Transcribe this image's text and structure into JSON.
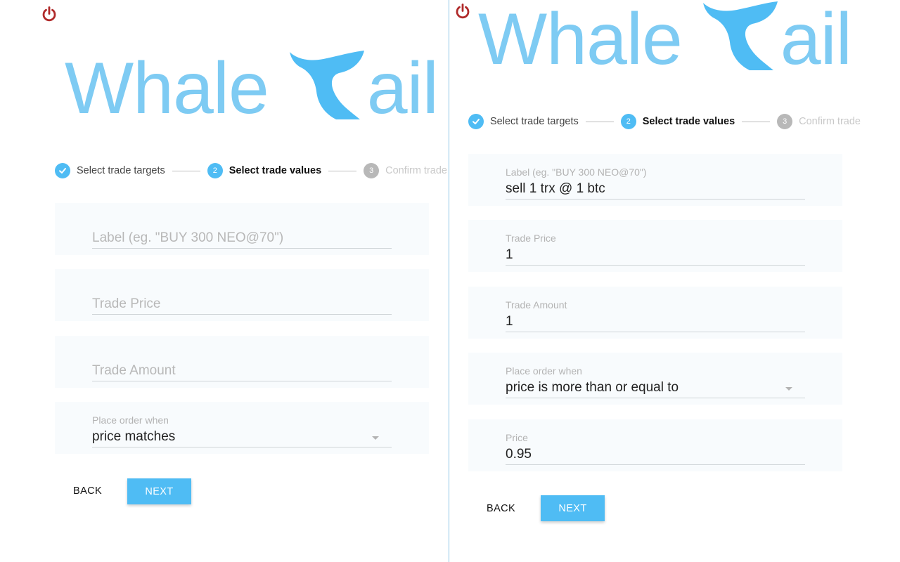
{
  "colors": {
    "accent": "#4fbcf4",
    "logo": "#7ecbf3",
    "power_icon": "#b02a2a",
    "field_bg": "#f8fbfd"
  },
  "logo": {
    "word_left": "Whale",
    "word_right": "ail"
  },
  "stepper": {
    "step1_label": "Select trade targets",
    "step2_number": "2",
    "step2_label": "Select trade values",
    "step3_number": "3",
    "step3_label": "Confirm trade"
  },
  "left_form": {
    "label_placeholder": "Label (eg. \"BUY 300 NEO@70\")",
    "trade_price_placeholder": "Trade Price",
    "trade_amount_placeholder": "Trade Amount",
    "place_order_label": "Place order when",
    "place_order_value": "price matches",
    "back_label": "BACK",
    "next_label": "NEXT"
  },
  "right_form": {
    "label_label": "Label (eg. \"BUY 300 NEO@70\")",
    "label_value": "sell 1 trx @ 1 btc",
    "trade_price_label": "Trade Price",
    "trade_price_value": "1",
    "trade_amount_label": "Trade Amount",
    "trade_amount_value": "1",
    "place_order_label": "Place order when",
    "place_order_value": "price is more than or equal to",
    "price_label": "Price",
    "price_value": "0.95",
    "back_label": "BACK",
    "next_label": "NEXT"
  }
}
